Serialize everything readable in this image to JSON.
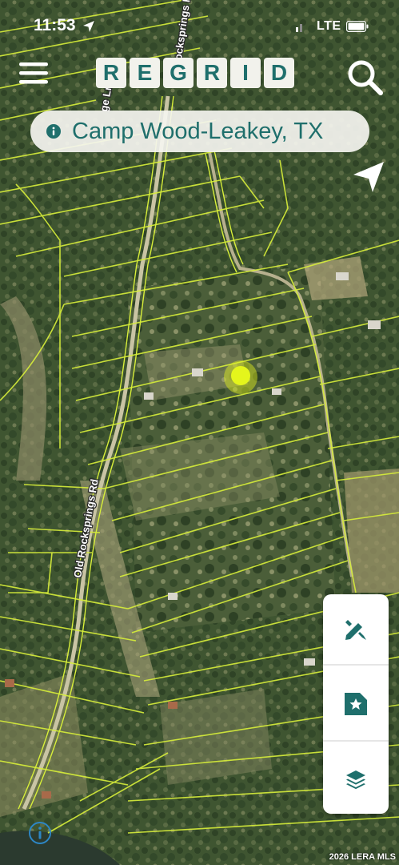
{
  "status_bar": {
    "time": "11:53",
    "network": "LTE",
    "icons": [
      "location-arrow-icon",
      "signal-icon",
      "battery-icon"
    ]
  },
  "header": {
    "logo_letters": [
      "R",
      "E",
      "G",
      "R",
      "I",
      "D"
    ],
    "icons": [
      "hamburger-menu-icon",
      "search-icon"
    ]
  },
  "location_bar": {
    "text": "Camp Wood-Leakey, TX",
    "icon": "info-icon"
  },
  "map": {
    "road_labels": [
      "Old Rocksprings Rd",
      "Old Rocksprings Rd",
      "ge Ln"
    ],
    "colors": {
      "parcel_line": "#d8ef3a",
      "selected_marker": "#e4f51c",
      "accent": "#1f6f6c"
    }
  },
  "tools": {
    "items": [
      "draw-icon",
      "saved-parcel-icon",
      "layers-icon"
    ]
  },
  "footer": {
    "copyright": "2026 LERA MLS",
    "attribution_icon": "info-icon"
  }
}
